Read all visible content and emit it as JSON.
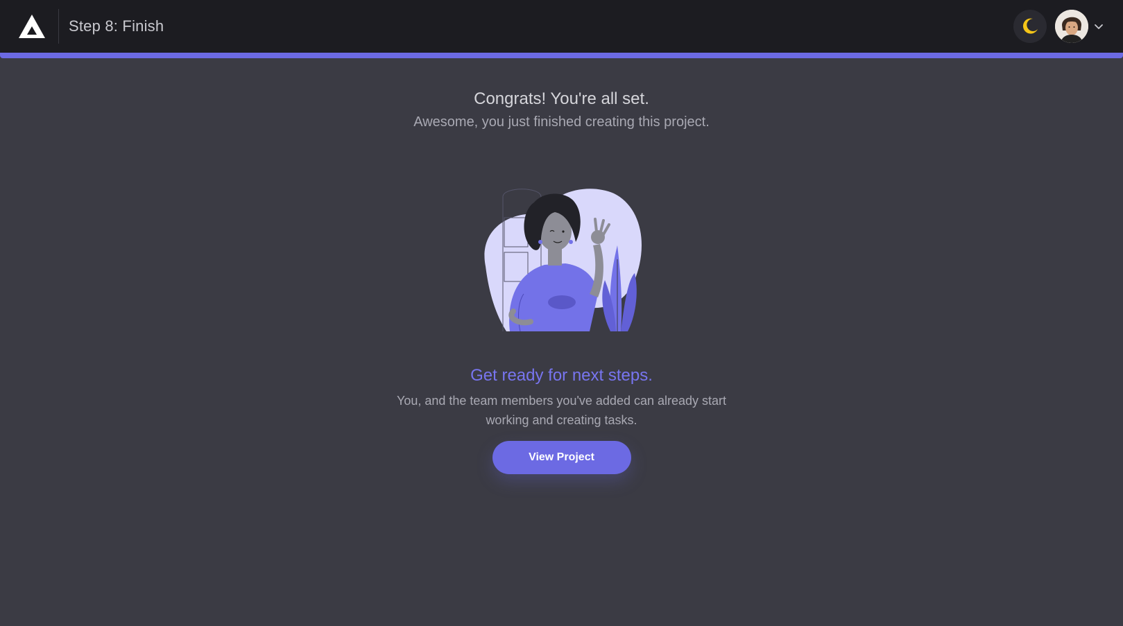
{
  "header": {
    "step_title": "Step 8: Finish",
    "logo_icon": "triangle-logo-icon",
    "theme_icon": "moon-icon",
    "avatar_icon": "user-avatar",
    "menu_icon": "chevron-down-icon"
  },
  "progress": {
    "percent": 100,
    "color": "#6c6ae3"
  },
  "main": {
    "heading": "Congrats! You're all set.",
    "subheading": "Awesome, you just finished creating this project.",
    "illustration": "woman-ok-gesture-illustration",
    "next_title": "Get ready for next steps.",
    "next_desc": "You, and the team members you've added can already start working and creating tasks.",
    "button_label": "View Project"
  },
  "colors": {
    "accent": "#6c6ae3",
    "background": "#3b3b44",
    "topbar": "#1c1c21",
    "moon": "#f5c518"
  }
}
